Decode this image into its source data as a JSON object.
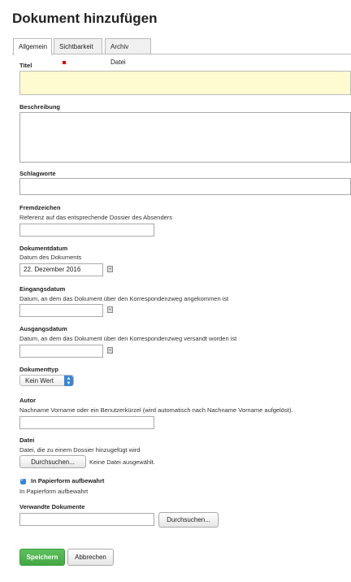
{
  "page": {
    "title": "Dokument hinzufügen"
  },
  "tabs": [
    {
      "label": "Allgemein",
      "active": true
    },
    {
      "label": "Sichtbarkeit",
      "active": false
    },
    {
      "label": "Archiv Datei",
      "active": false
    }
  ],
  "fields": {
    "titel": {
      "label": "Titel",
      "value": ""
    },
    "beschreibung": {
      "label": "Beschreibung",
      "value": ""
    },
    "schlagworte": {
      "label": "Schlagworte",
      "value": ""
    },
    "fremdzeichen": {
      "label": "Fremdzeichen",
      "help": "Referenz auf das entsprechende Dossier des Absenders",
      "value": ""
    },
    "dokumentdatum": {
      "label": "Dokumentdatum",
      "help": "Datum des Dokuments",
      "value": "22. Dezember 2016"
    },
    "eingangsdatum": {
      "label": "Eingangsdatum",
      "help": "Datum, an dem das Dokument über den Korrespondenzweg angekommen ist",
      "value": ""
    },
    "ausgangsdatum": {
      "label": "Ausgangsdatum",
      "help": "Datum, an dem das Dokument über den Korrespondenzweg versandt worden ist",
      "value": ""
    },
    "dokumenttyp": {
      "label": "Dokumenttyp",
      "value": "Kein Wert"
    },
    "autor": {
      "label": "Autor",
      "help": "Nachname Vorname oder ein Benutzerkürzel (wird automatisch nach Nachname Vorname aufgelöst).",
      "value": ""
    },
    "datei": {
      "label": "Datei",
      "help": "Datei, die zu einem Dossier hinzugefügt wird",
      "button": "Durchsuchen...",
      "status": "Keine Datei ausgewählt."
    },
    "papierform": {
      "label": "In Papierform aufbewahrt",
      "help": "In Papierform aufbewahrt",
      "checked": true
    },
    "verwandte": {
      "label": "Verwandte Dokumente",
      "value": "",
      "button": "Durchsuchen..."
    }
  },
  "actions": {
    "save": "Speichern",
    "cancel": "Abbrechen"
  },
  "colors": {
    "accent_blue": "#3a86d6",
    "save_green": "#4cae4c",
    "title_field_bg": "#fffbd1",
    "unsaved_marker": "#dd0000"
  }
}
